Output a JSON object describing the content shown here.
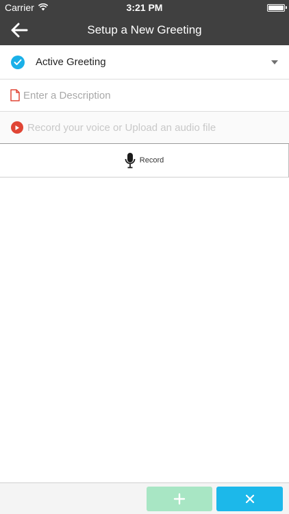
{
  "status_bar": {
    "carrier": "Carrier",
    "time": "3:21 PM",
    "icons": [
      "wifi-icon",
      "battery-icon"
    ]
  },
  "nav": {
    "title": "Setup a New Greeting",
    "back_icon": "arrow-left-icon"
  },
  "greeting": {
    "active_label": "Active Greeting",
    "active_checked": true,
    "dropdown_icon": "caret-down-icon"
  },
  "description": {
    "placeholder": "Enter a Description",
    "value": ""
  },
  "recording": {
    "hint": "Record your voice or Upload an audio file",
    "record_label": "Record",
    "record_icon": "microphone-icon"
  },
  "footer": {
    "add_icon": "plus-icon",
    "close_icon": "x-icon"
  },
  "colors": {
    "header_bg": "#404040",
    "accent_blue": "#1ab0e8",
    "accent_red": "#e04535",
    "add_green": "#a8e6c4",
    "close_blue": "#1cb8ea"
  }
}
